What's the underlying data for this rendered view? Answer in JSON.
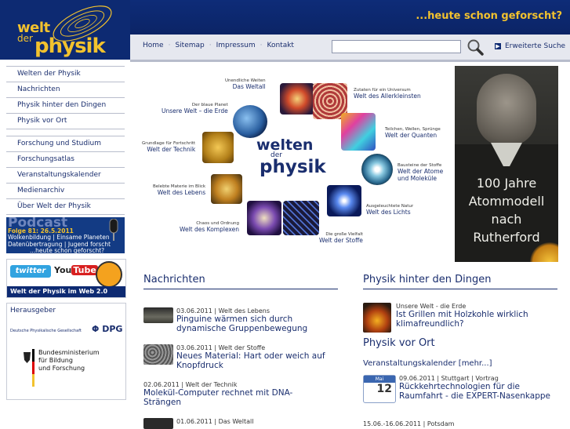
{
  "header": {
    "logo": {
      "line1": "welt",
      "line2": "der",
      "line3": "physik"
    },
    "tagline": "...heute schon geforscht?"
  },
  "nav": {
    "links": [
      "Home",
      "Sitemap",
      "Impressum",
      "Kontakt"
    ],
    "search_value": "",
    "advanced_search": "Erweiterte Suche"
  },
  "sidebar": {
    "group1": [
      "Welten der Physik",
      "Nachrichten",
      "Physik hinter den Dingen",
      "Physik vor Ort"
    ],
    "group2": [
      "Forschung und Studium",
      "Forschungsatlas",
      "Veranstaltungskalender",
      "Medienarchiv",
      "Über Welt der Physik"
    ]
  },
  "podcast": {
    "title": "Podcast",
    "line1": "Folge 81: 26.5.2011",
    "line2": "Wolkenbildung | Einsame Planeten",
    "line3": "Datenübertragung | Jugend forscht",
    "line4": "...heute schon geforscht?"
  },
  "web20": {
    "twitter": "twitter",
    "youtube_1": "You",
    "youtube_2": "Tube",
    "caption": "Welt der Physik im Web 2.0"
  },
  "publisher": {
    "heading": "Herausgeber",
    "dpg_name": "Deutsche Physikalische Gesellschaft",
    "dpg_logo": "DPG",
    "bmbf_1": "Bundesministerium",
    "bmbf_2": "für Bildung",
    "bmbf_3": "und Forschung"
  },
  "banner": {
    "wordmark_1": "welten",
    "wordmark_2": "der",
    "wordmark_3": "physik",
    "items": [
      {
        "small": "Unendliche Weiten",
        "big": "Das Weltall"
      },
      {
        "small": "Zutaten für ein Universum",
        "big": "Welt des Allerkleinsten"
      },
      {
        "small": "Der blaue Planet",
        "big": "Unsere Welt – die Erde"
      },
      {
        "small": "Teilchen, Wellen, Sprünge",
        "big": "Welt der Quanten"
      },
      {
        "small": "Grundlage für Fortschritt",
        "big": "Welt der Technik"
      },
      {
        "small": "Bausteine der Stoffe",
        "big": "Welt der Atome und Moleküle"
      },
      {
        "small": "Belebte Materie im Blick",
        "big": "Welt des Lebens"
      },
      {
        "small": "Ausgeleuchtete Natur",
        "big": "Welt des Lichts"
      },
      {
        "small": "Chaos und Ordnung",
        "big": "Welt des Komplexen"
      },
      {
        "small": "Die große Vielfalt",
        "big": "Welt der Stoffe"
      }
    ]
  },
  "rutherford": {
    "line1": "100 Jahre",
    "line2": "Atommodell",
    "line3": "nach",
    "line4": "Rutherford"
  },
  "nachrichten": {
    "title": "Nachrichten",
    "items": [
      {
        "meta": "03.06.2011 | Welt des Lebens",
        "head": "Pinguine wärmen sich durch dynamische Gruppenbewegung"
      },
      {
        "meta": "03.06.2011 | Welt der Stoffe",
        "head": "Neues Material: Hart oder weich auf Knopfdruck"
      },
      {
        "meta": "02.06.2011 | Welt der Technik",
        "head": "Molekül-Computer rechnet mit DNA-Strängen"
      },
      {
        "meta": "01.06.2011 | Das Weltall",
        "head": ""
      }
    ]
  },
  "phd": {
    "title": "Physik hinter den Dingen",
    "meta": "Unsere Welt - die Erde",
    "head": "Ist Grillen mit Holzkohle wirklich klimafreundlich?"
  },
  "pvo": {
    "title": "Physik vor Ort",
    "link": "Veranstaltungskalender [mehr...]",
    "cal_month": "Mai",
    "cal_day": "12",
    "event1_meta": "09.06.2011 | Stuttgart | Vortrag",
    "event1_head": "Rückkehrtechnologien für die Raumfahrt - die EXPERT-Nasenkappe",
    "event2_meta": "15.06.-16.06.2011 | Potsdam"
  }
}
